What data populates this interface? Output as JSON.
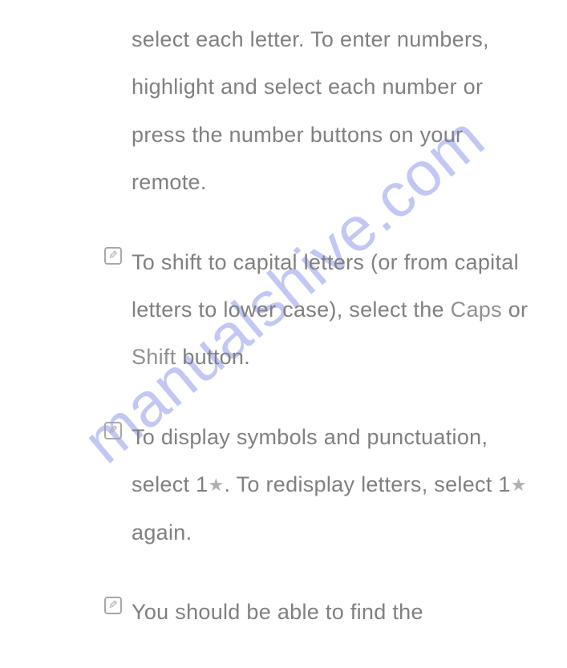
{
  "watermark": "manualshive.com",
  "paragraphs": {
    "p0": {
      "text": "select each letter. To enter numbers, highlight and select each number or press the number buttons on your remote."
    },
    "p1": {
      "prefix": "To shift to capital letters (or from capital letters to lower case), select the ",
      "kw1": "Caps",
      "mid": " or ",
      "kw2": "Shift",
      "suffix": " button."
    },
    "p2": {
      "prefix": "To display symbols and punctuation, select 1",
      "mid": ". To redisplay letters, select 1",
      "suffix": " again."
    },
    "p3": {
      "text": "You should be able to find the"
    }
  },
  "icons": {
    "note": "note-icon",
    "star": "★"
  }
}
